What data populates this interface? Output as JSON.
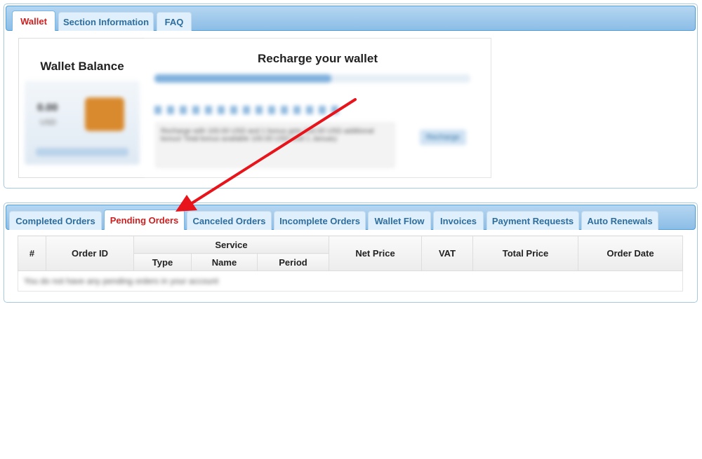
{
  "top_tabs": [
    {
      "label": "Wallet",
      "active": true
    },
    {
      "label": "Section Information",
      "active": false
    },
    {
      "label": "FAQ",
      "active": false
    }
  ],
  "wallet": {
    "balance_title": "Wallet Balance",
    "amount": "0.00",
    "currency": "USD",
    "recharge_title": "Recharge your wallet",
    "info_text": "Recharge with 100.00 USD and 1 bonus gets 100.00 USD additional bonus! Total bonus available 100.00 USD until 1 January",
    "recharge_button": "Recharge"
  },
  "order_tabs": [
    {
      "label": "Completed Orders",
      "active": false
    },
    {
      "label": "Pending Orders",
      "active": true
    },
    {
      "label": "Canceled Orders",
      "active": false
    },
    {
      "label": "Incomplete Orders",
      "active": false
    },
    {
      "label": "Wallet Flow",
      "active": false
    },
    {
      "label": "Invoices",
      "active": false
    },
    {
      "label": "Payment Requests",
      "active": false
    },
    {
      "label": "Auto Renewals",
      "active": false
    }
  ],
  "table": {
    "col_num": "#",
    "col_order_id": "Order ID",
    "col_service": "Service",
    "col_type": "Type",
    "col_name": "Name",
    "col_period": "Period",
    "col_net_price": "Net Price",
    "col_vat": "VAT",
    "col_total_price": "Total Price",
    "col_order_date": "Order Date",
    "empty_message": "You do not have any pending orders in your account"
  },
  "colors": {
    "active_tab_text": "#cc1f1f",
    "tab_text": "#2e6e9e",
    "arrow": "#e8141b"
  }
}
